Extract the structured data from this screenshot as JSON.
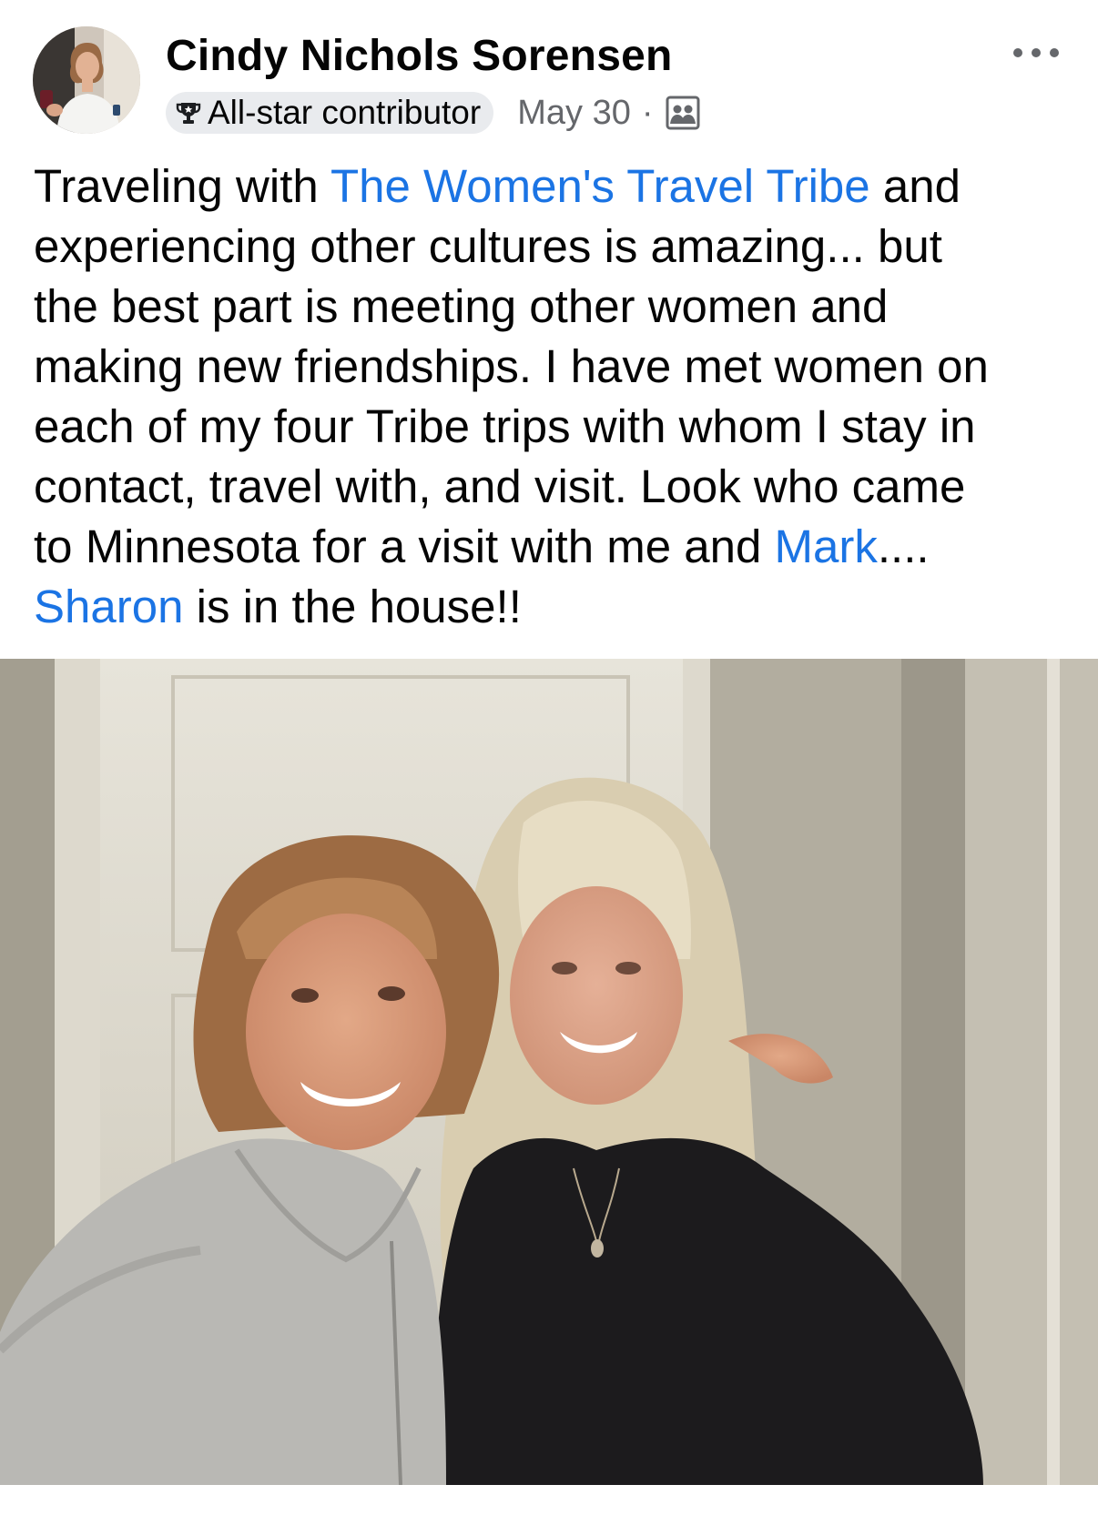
{
  "post": {
    "author": {
      "name": "Cindy Nichols Sorensen",
      "badge": "All-star contributor"
    },
    "date": "May 30",
    "separator": "·",
    "icons": {
      "badge": "trophy-icon",
      "audience": "group-members-icon",
      "more": "more-options-icon"
    },
    "body": {
      "line1": {
        "pre": "Traveling with  ",
        "link": "The Women's Travel Tribe",
        "post": " and"
      },
      "line2": "experiencing other cultures is amazing... but",
      "line3": "the best part is meeting other women and",
      "line4": "making new friendships. I have met women on",
      "line5": "each of my four Tribe trips with whom I stay in",
      "line6": "contact, travel with, and visit.  Look who came",
      "line7": {
        "pre": "to Minnesota for a visit with me and ",
        "link": "Mark",
        "post": "...."
      },
      "line8": {
        "link": "Sharon",
        "post": " is in the house!!"
      }
    },
    "colors": {
      "link": "#1b74e4",
      "meta": "#65676b",
      "badge_bg": "#e9ebee"
    }
  }
}
